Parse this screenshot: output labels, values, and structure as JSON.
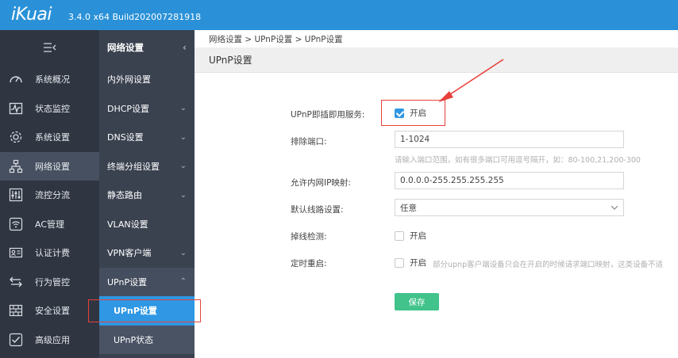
{
  "header": {
    "logo": "iKuai",
    "version": "3.4.0 x64 Build202007281918"
  },
  "sidebar": {
    "items": [
      {
        "label": "系统概况",
        "icon": "gauge-icon"
      },
      {
        "label": "状态监控",
        "icon": "pulse-icon"
      },
      {
        "label": "系统设置",
        "icon": "gear-icon"
      },
      {
        "label": "网络设置",
        "icon": "network-icon",
        "active": true
      },
      {
        "label": "流控分流",
        "icon": "sliders-icon"
      },
      {
        "label": "AC管理",
        "icon": "wifi-icon"
      },
      {
        "label": "认证计费",
        "icon": "id-card-icon"
      },
      {
        "label": "行为管控",
        "icon": "swap-arrows-icon"
      },
      {
        "label": "安全设置",
        "icon": "firewall-icon"
      },
      {
        "label": "高级应用",
        "icon": "checklist-icon"
      }
    ]
  },
  "subnav": {
    "title": "网络设置",
    "items": {
      "wan_lan": "内外网设置",
      "dhcp": "DHCP设置",
      "dns": "DNS设置",
      "terminal_group": "终端分组设置",
      "static_route": "静态路由",
      "vlan": "VLAN设置",
      "vpn_client": "VPN客户端",
      "upnp": "UPnP设置",
      "upnp_sub_settings": "UPnP设置",
      "upnp_sub_status": "UPnP状态"
    }
  },
  "breadcrumb": "网络设置 > UPnP设置 > UPnP设置",
  "page_title": "UPnP设置",
  "form": {
    "upnp_service_label": "UPnP即插即用服务:",
    "upnp_service_option": "开启",
    "upnp_service_checked": true,
    "exclude_ports_label": "排除端口:",
    "exclude_ports_value": "1-1024",
    "exclude_ports_hint": "请输入端口范围，如有很多端口可用逗号隔开，如：80-100,21,200-300",
    "allow_lan_ip_label": "允许内网IP映射:",
    "allow_lan_ip_value": "0.0.0.0-255.255.255.255",
    "default_line_label": "默认线路设置:",
    "default_line_value": "任意",
    "drop_detect_label": "掉线检测:",
    "drop_detect_option": "开启",
    "drop_detect_checked": false,
    "scheduled_restart_label": "定时重启:",
    "scheduled_restart_option": "开启",
    "scheduled_restart_checked": false,
    "scheduled_restart_hint": "部分upnp客户端设备只会在开启的时候请求端口映射，这类设备不适",
    "save_label": "保存"
  },
  "colors": {
    "header": "#2a91d8",
    "sidebar": "#2f3541",
    "subnav": "#3a4250",
    "selected": "#2f97e3",
    "save": "#41c38b",
    "annotation": "#e8413b"
  }
}
